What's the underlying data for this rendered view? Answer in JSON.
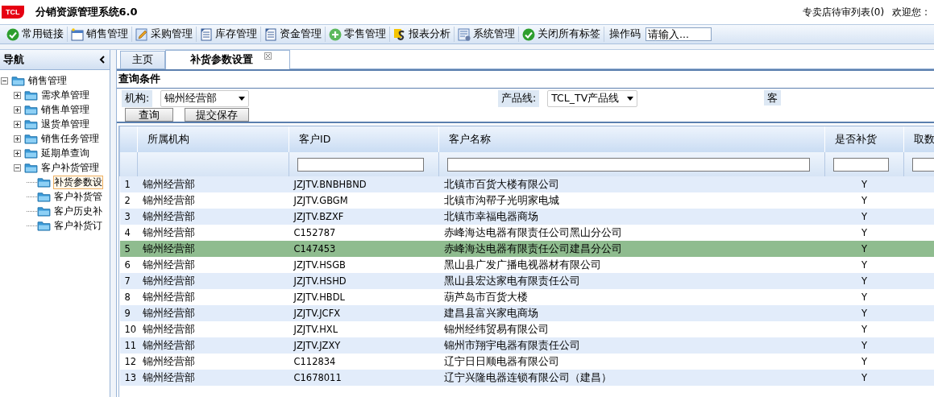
{
  "header": {
    "logo": "TCL",
    "title": "分销资源管理系统6.0",
    "links": [
      "专卖店待审列表(0)",
      "欢迎您 :"
    ]
  },
  "toolbar": {
    "items": [
      {
        "label": "常用链接",
        "kind": "check"
      },
      {
        "label": "销售管理",
        "kind": "new"
      },
      {
        "label": "采购管理",
        "kind": "edit"
      },
      {
        "label": "库存管理",
        "kind": "doc"
      },
      {
        "label": "资金管理",
        "kind": "doc"
      },
      {
        "label": "零售管理",
        "kind": "plus"
      },
      {
        "label": "报表分析",
        "kind": "report"
      },
      {
        "label": "系统管理",
        "kind": "system"
      },
      {
        "label": "关闭所有标签",
        "kind": "check"
      }
    ],
    "code_label": "操作码",
    "code_field": {
      "placeholder": "请输入..."
    }
  },
  "nav": {
    "title": "导航",
    "tree": [
      {
        "label": "销售管理",
        "expanded": true,
        "selected": false,
        "children": [
          {
            "label": "需求单管理",
            "expanded": false,
            "selected": false
          },
          {
            "label": "销售单管理",
            "expanded": false,
            "selected": false
          },
          {
            "label": "退货单管理",
            "expanded": false,
            "selected": false
          },
          {
            "label": "销售任务管理",
            "expanded": false,
            "selected": false
          },
          {
            "label": "延期单查询",
            "expanded": false,
            "selected": false
          },
          {
            "label": "客户补货管理",
            "expanded": true,
            "selected": false,
            "children": [
              {
                "label": "补货参数设",
                "selected": true
              },
              {
                "label": "客户补货管",
                "selected": false
              },
              {
                "label": "客户历史补",
                "selected": false
              },
              {
                "label": "客户补货订",
                "selected": false
              }
            ]
          }
        ]
      }
    ]
  },
  "tabs": [
    {
      "label": "主页",
      "selected": false,
      "closable": false
    },
    {
      "label": "补货参数设置",
      "selected": true,
      "closable": true
    }
  ],
  "query": {
    "title": "查询条件",
    "fields": [
      {
        "label": "机构:",
        "value": "锦州经营部"
      },
      {
        "label": "产品线:",
        "value": "TCL_TV产品线"
      },
      {
        "label": "客"
      }
    ],
    "buttons": [
      "查询",
      "提交保存"
    ]
  },
  "table": {
    "columns": [
      "所属机构",
      "客户ID",
      "客户名称",
      "是否补货",
      "取数"
    ],
    "rows": [
      {
        "num": "1",
        "org": "锦州经营部",
        "id": "JZJTV.BNBHBND",
        "name": "北镇市百货大楼有限公司",
        "replenish": "Y",
        "selected": false
      },
      {
        "num": "2",
        "org": "锦州经营部",
        "id": "JZJTV.GBGM",
        "name": "北镇市沟帮子光明家电城",
        "replenish": "Y",
        "selected": false
      },
      {
        "num": "3",
        "org": "锦州经营部",
        "id": "JZJTV.BZXF",
        "name": "北镇市幸福电器商场",
        "replenish": "Y",
        "selected": false
      },
      {
        "num": "4",
        "org": "锦州经营部",
        "id": "C152787",
        "name": "赤峰海达电器有限责任公司黑山分公司",
        "replenish": "Y",
        "selected": false
      },
      {
        "num": "5",
        "org": "锦州经营部",
        "id": "C147453",
        "name": "赤峰海达电器有限责任公司建昌分公司",
        "replenish": "Y",
        "selected": true
      },
      {
        "num": "6",
        "org": "锦州经营部",
        "id": "JZJTV.HSGB",
        "name": "黑山县广发广播电视器材有限公司",
        "replenish": "Y",
        "selected": false
      },
      {
        "num": "7",
        "org": "锦州经营部",
        "id": "JZJTV.HSHD",
        "name": "黑山县宏达家电有限责任公司",
        "replenish": "Y",
        "selected": false
      },
      {
        "num": "8",
        "org": "锦州经营部",
        "id": "JZJTV.HBDL",
        "name": "葫芦岛市百货大楼",
        "replenish": "Y",
        "selected": false
      },
      {
        "num": "9",
        "org": "锦州经营部",
        "id": "JZJTV.JCFX",
        "name": "建昌县富兴家电商场",
        "replenish": "Y",
        "selected": false
      },
      {
        "num": "10",
        "org": "锦州经营部",
        "id": "JZJTV.HXL",
        "name": "锦州经纬贸易有限公司",
        "replenish": "Y",
        "selected": false
      },
      {
        "num": "11",
        "org": "锦州经营部",
        "id": "JZJTV.JZXY",
        "name": "锦州市翔宇电器有限责任公司",
        "replenish": "Y",
        "selected": false
      },
      {
        "num": "12",
        "org": "锦州经营部",
        "id": "C112834",
        "name": "辽宁日日顺电器有限公司",
        "replenish": "Y",
        "selected": false
      },
      {
        "num": "13",
        "org": "锦州经营部",
        "id": "C1678011",
        "name": "辽宁兴隆电器连锁有限公司（建昌）",
        "replenish": "Y",
        "selected": false
      }
    ]
  }
}
